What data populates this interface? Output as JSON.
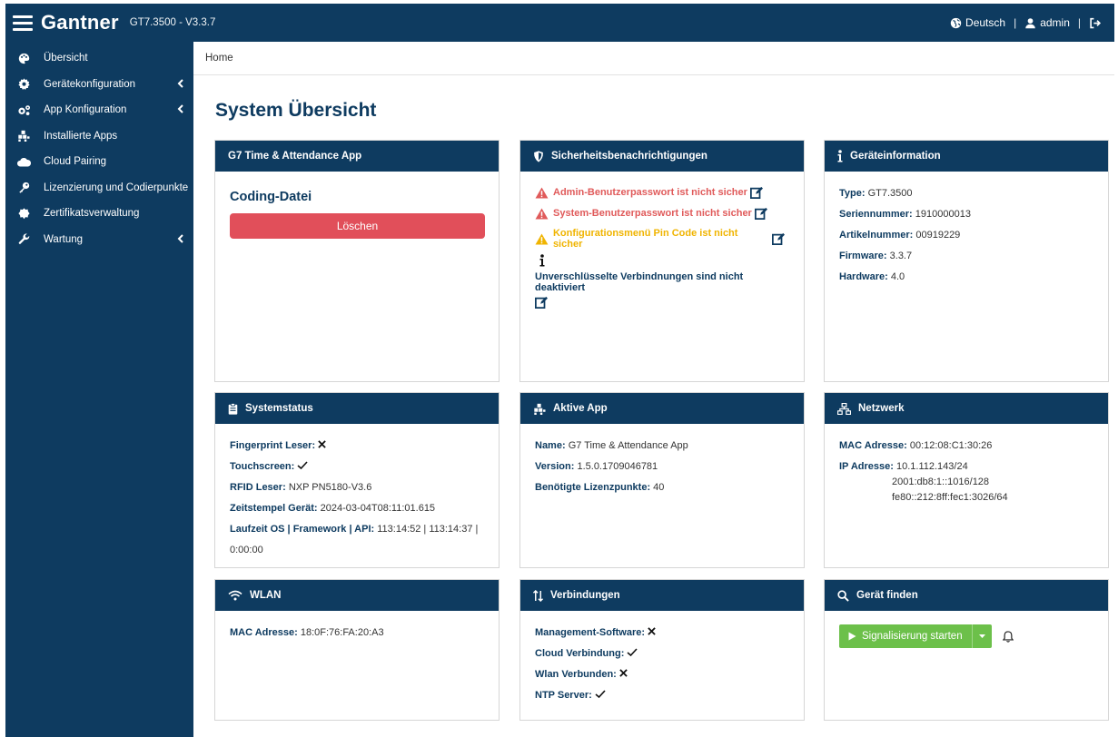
{
  "topbar": {
    "brand": "Gantner",
    "version": "GT7.3500 - V3.3.7",
    "language": "Deutsch",
    "user": "admin",
    "separator": "|"
  },
  "sidebar": {
    "items": [
      {
        "label": "Übersicht",
        "icon": "palette-icon"
      },
      {
        "label": "Gerätekonfiguration",
        "icon": "gear-icon"
      },
      {
        "label": "App Konfiguration",
        "icon": "gears-icon"
      },
      {
        "label": "Installierte Apps",
        "icon": "apps-icon"
      },
      {
        "label": "Cloud Pairing",
        "icon": "cloud-icon"
      },
      {
        "label": "Lizenzierung und Codierpunkte",
        "icon": "key-icon"
      },
      {
        "label": "Zertifikatsverwaltung",
        "icon": "certificate-icon"
      },
      {
        "label": "Wartung",
        "icon": "wrench-icon"
      }
    ]
  },
  "breadcrumb": "Home",
  "page_title": "System Übersicht",
  "cards": {
    "app": {
      "title": "G7 Time & Attendance App",
      "coding_title": "Coding-Datei",
      "delete_label": "Löschen"
    },
    "security": {
      "title": "Sicherheitsbenachrichtigungen",
      "warnings": [
        "Admin-Benutzerpasswort ist nicht sicher",
        "System-Benutzerpasswort ist nicht sicher",
        "Konfigurationsmenü Pin Code ist nicht sicher"
      ],
      "info": "Unverschlüsselte Verbindnungen sind nicht deaktiviert"
    },
    "device": {
      "title": "Geräteinformation",
      "rows": [
        {
          "label": "Type:",
          "value": "GT7.3500"
        },
        {
          "label": "Seriennummer:",
          "value": "1910000013"
        },
        {
          "label": "Artikelnummer:",
          "value": "00919229"
        },
        {
          "label": "Firmware:",
          "value": "3.3.7"
        },
        {
          "label": "Hardware:",
          "value": "4.0"
        }
      ]
    },
    "status": {
      "title": "Systemstatus",
      "fingerprint_label": "Fingerprint Leser:",
      "touchscreen_label": "Touchscreen:",
      "rfid_label": "RFID Leser:",
      "rfid_value": "NXP PN5180-V3.6",
      "timestamp_label": "Zeitstempel Gerät:",
      "timestamp_value": "2024-03-04T08:11:01.615",
      "runtime_label": "Laufzeit OS | Framework | API:",
      "runtime_value": "113:14:52 | 113:14:37 |",
      "runtime_value2": "0:00:00"
    },
    "active_app": {
      "title": "Aktive App",
      "rows": [
        {
          "label": "Name:",
          "value": "G7 Time & Attendance App"
        },
        {
          "label": "Version:",
          "value": "1.5.0.1709046781"
        },
        {
          "label": "Benötigte Lizenzpunkte:",
          "value": "40"
        }
      ]
    },
    "network": {
      "title": "Netzwerk",
      "mac_label": "MAC Adresse:",
      "mac_value": "00:12:08:C1:30:26",
      "ip_label": "IP Adresse:",
      "ip_values": [
        "10.1.112.143/24",
        "2001:db8:1::1016/128",
        "fe80::212:8ff:fec1:3026/64"
      ]
    },
    "wlan": {
      "title": "WLAN",
      "mac_label": "MAC Adresse:",
      "mac_value": "18:0F:76:FA:20:A3"
    },
    "connections": {
      "title": "Verbindungen",
      "rows": [
        {
          "label": "Management-Software:",
          "status": "cross"
        },
        {
          "label": "Cloud Verbindung:",
          "status": "check"
        },
        {
          "label": "Wlan Verbunden:",
          "status": "cross"
        },
        {
          "label": "NTP Server:",
          "status": "check"
        }
      ]
    },
    "find": {
      "title": "Gerät finden",
      "signal_label": "Signalisierung starten"
    }
  },
  "colors": {
    "navy": "#0e3b60",
    "danger": "#e14f5a",
    "warning": "#f0b400",
    "success": "#6cc04a"
  }
}
